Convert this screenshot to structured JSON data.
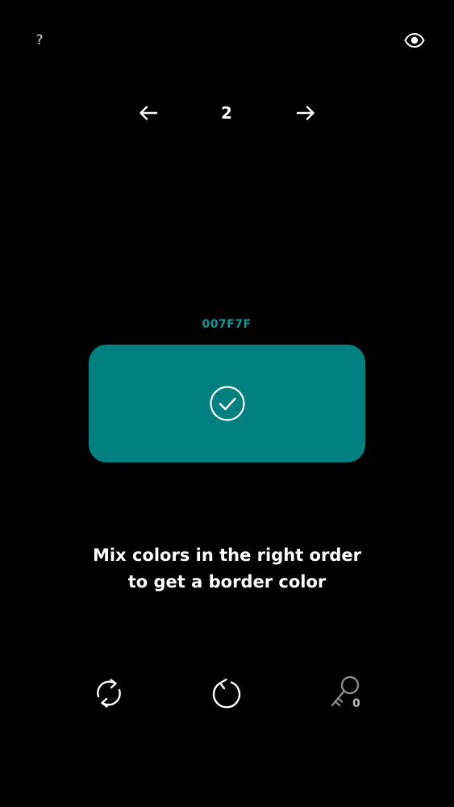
{
  "header": {
    "help_label": "?"
  },
  "level": {
    "number": "2"
  },
  "target": {
    "hex": "007F7F",
    "color": "#008080",
    "hex_text_color": "#0c9a9a"
  },
  "instruction": {
    "line1": "Mix colors in the right order",
    "line2": "to get a border color"
  },
  "toolbar": {
    "key_count": "0"
  }
}
